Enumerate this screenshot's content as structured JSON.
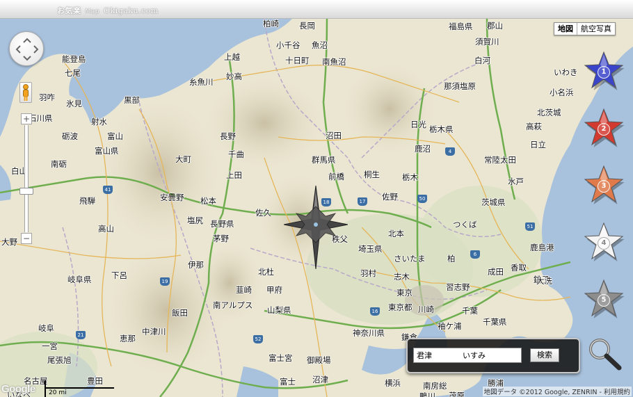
{
  "header": {
    "brand_name": "お気楽",
    "brand_tag": "Map",
    "brand_domain": "Okigaku.com"
  },
  "map_type": {
    "map_label": "地図",
    "satellite_label": "航空写真"
  },
  "zoom": {
    "plus": "+",
    "minus": "−",
    "level_fraction": 0.62
  },
  "stars": [
    {
      "label": "1",
      "color": "#3b45c9"
    },
    {
      "label": "2",
      "color": "#d33a2f"
    },
    {
      "label": "3",
      "color": "#e07a4a"
    },
    {
      "label": "4",
      "color": "#f4f4f4"
    },
    {
      "label": "5",
      "color": "#8d8d8d"
    }
  ],
  "search": {
    "value": "君津　　　　いすみ",
    "button_label": "検索"
  },
  "footer": {
    "copyright": "地図データ ©2012 Google, ZENRIN - 利用規約",
    "google_logo": "Google",
    "scale_label": "20 mi"
  },
  "places": [
    "柏崎",
    "長岡",
    "郡山",
    "福島県",
    "小千谷",
    "魚沼",
    "須賀川",
    "上越",
    "十日町",
    "南魚沼",
    "白河",
    "能登島",
    "七尾",
    "妙高",
    "いわき",
    "羽咋",
    "那須塩原",
    "糸魚川",
    "氷見",
    "小名浜",
    "黒部",
    "石川県",
    "射水",
    "北茨城",
    "日光",
    "沼田",
    "栃木県",
    "高萩",
    "砺波",
    "富山",
    "長野",
    "富山県",
    "鹿沼",
    "日立",
    "千曲",
    "常陸太田",
    "大町",
    "群馬県",
    "南砺",
    "上田",
    "白山",
    "桐生",
    "栃木",
    "水戸",
    "前橋",
    "安曇野",
    "松本",
    "佐野",
    "飛騨",
    "茨城県",
    "佐久",
    "塩尻",
    "つくば",
    "長野県",
    "北本",
    "高山",
    "茅野",
    "秩父",
    "埼玉県",
    "大野",
    "伊那",
    "さいたま",
    "柏",
    "北杜",
    "羽村",
    "成田",
    "志木",
    "香取",
    "下呂",
    "岐阜県",
    "銚子",
    "韮崎",
    "東京",
    "甲府",
    "習志野",
    "南アルプス",
    "飯田",
    "東京都",
    "川崎",
    "千葉",
    "山梨県",
    "中津川",
    "袖ケ浦",
    "千葉県",
    "岐阜",
    "恵那",
    "神奈川県",
    "一宮",
    "横浜",
    "鎌倉",
    "富士宮",
    "御殿場",
    "尾張旭",
    "富士",
    "沼津",
    "名古屋",
    "豊田",
    "南房総",
    "勝浦",
    "いなべ",
    "鴨川",
    "茂原",
    "鹿島港",
    "大洗"
  ]
}
